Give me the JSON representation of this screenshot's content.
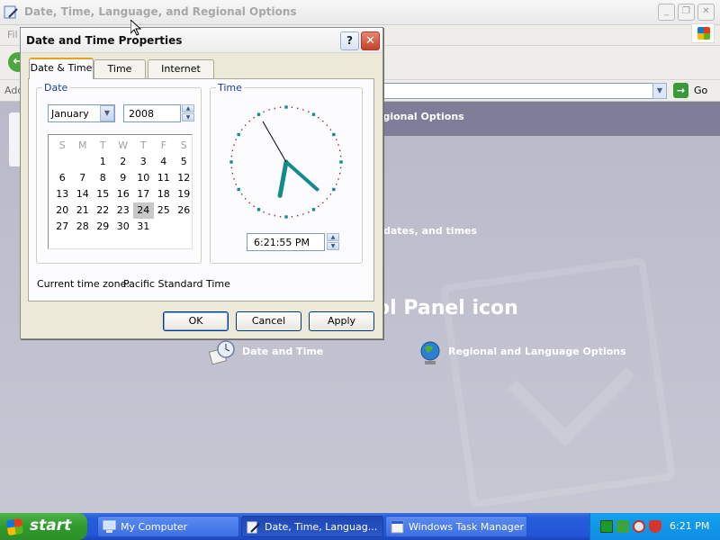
{
  "background_window": {
    "title": "Date, Time, Language, and Regional Options",
    "menu_first_char": "Fil",
    "address_label": "Add",
    "go_label": "Go",
    "band_text": "egional Options",
    "task_text": ", dates, and times",
    "pick_text": "ol Panel icon",
    "items": [
      {
        "label": "Date and Time",
        "icon": "date-time-icon"
      },
      {
        "label": "Regional and Language Options",
        "icon": "globe-icon"
      }
    ]
  },
  "dialog": {
    "title": "Date and Time Properties",
    "tabs": [
      "Date & Time",
      "Time Zone",
      "Internet Time"
    ],
    "active_tab": 0,
    "date_group": "Date",
    "time_group": "Time",
    "month": "January",
    "year": "2008",
    "day_headers": [
      "S",
      "M",
      "T",
      "W",
      "T",
      "F",
      "S"
    ],
    "weeks": [
      [
        "",
        "",
        "1",
        "2",
        "3",
        "4",
        "5"
      ],
      [
        "6",
        "7",
        "8",
        "9",
        "10",
        "11",
        "12"
      ],
      [
        "13",
        "14",
        "15",
        "16",
        "17",
        "18",
        "19"
      ],
      [
        "20",
        "21",
        "22",
        "23",
        "24",
        "25",
        "26"
      ],
      [
        "27",
        "28",
        "29",
        "30",
        "31",
        "",
        ""
      ]
    ],
    "selected_day": "24",
    "time_value": "6:21:55 PM",
    "timezone_label": "Current time zone:",
    "timezone_value": "Pacific Standard Time",
    "buttons": {
      "ok": "OK",
      "cancel": "Cancel",
      "apply": "Apply"
    }
  },
  "taskbar": {
    "start_label": "start",
    "items": [
      {
        "label": "My Computer",
        "active": false
      },
      {
        "label": "Date, Time, Languag...",
        "active": true
      },
      {
        "label": "Windows Task Manager",
        "active": false
      }
    ],
    "clock": "6:21 PM"
  },
  "colors": {
    "clock_hands": "#148b8b",
    "tab_highlight": "#e6a127",
    "taskbar": "#245edb"
  }
}
